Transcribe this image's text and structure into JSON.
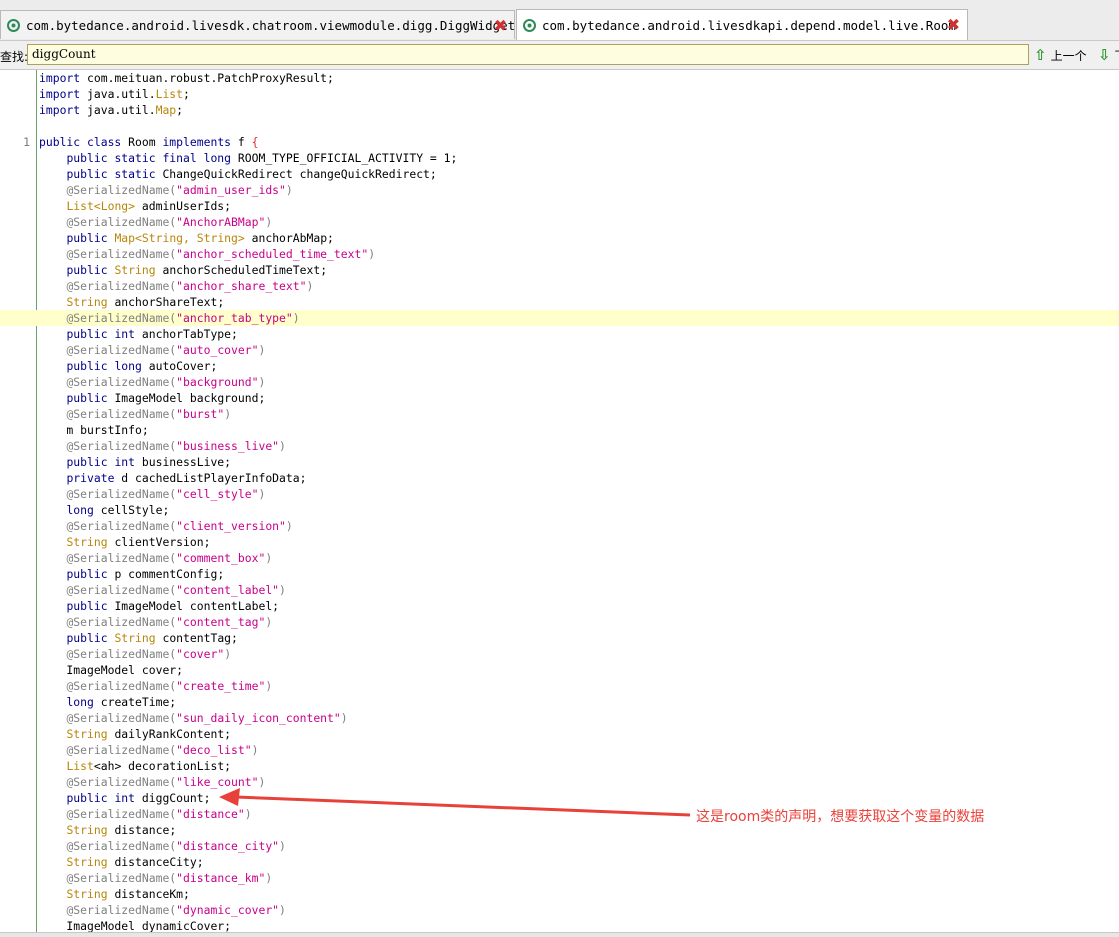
{
  "tabs": [
    {
      "label": "com.bytedance.android.livesdk.chatroom.viewmodule.digg.DiggWidget",
      "close": "✖",
      "active": false
    },
    {
      "label": "com.bytedance.android.livesdkapi.depend.model.live.Room",
      "close": "✖",
      "active": true
    }
  ],
  "find": {
    "label": "查找:",
    "value": "diggCount",
    "prev_label": "上一个",
    "next_label": "下"
  },
  "code_lines": [
    {
      "n": "",
      "hl": false,
      "tokens": [
        {
          "c": "kw",
          "t": "import"
        },
        {
          "c": "",
          "t": " com.meituan.robust.PatchProxyResult;"
        }
      ]
    },
    {
      "n": "",
      "hl": false,
      "tokens": [
        {
          "c": "kw",
          "t": "import"
        },
        {
          "c": "",
          "t": " java.util."
        },
        {
          "c": "ty",
          "t": "List"
        },
        {
          "c": "",
          "t": ";"
        }
      ]
    },
    {
      "n": "",
      "hl": false,
      "tokens": [
        {
          "c": "kw",
          "t": "import"
        },
        {
          "c": "",
          "t": " java.util."
        },
        {
          "c": "ty",
          "t": "Map"
        },
        {
          "c": "",
          "t": ";"
        }
      ]
    },
    {
      "n": "",
      "hl": false,
      "tokens": []
    },
    {
      "n": "1",
      "hl": false,
      "tokens": [
        {
          "c": "kw",
          "t": "public class"
        },
        {
          "c": "",
          "t": " Room "
        },
        {
          "c": "kw",
          "t": "implements"
        },
        {
          "c": "",
          "t": " f "
        },
        {
          "c": "brace",
          "t": "{"
        }
      ]
    },
    {
      "n": "",
      "hl": false,
      "tokens": [
        {
          "c": "",
          "t": "    "
        },
        {
          "c": "kw",
          "t": "public static final long"
        },
        {
          "c": "",
          "t": " ROOM_TYPE_OFFICIAL_ACTIVITY = 1;"
        }
      ]
    },
    {
      "n": "",
      "hl": false,
      "tokens": [
        {
          "c": "",
          "t": "    "
        },
        {
          "c": "kw",
          "t": "public static"
        },
        {
          "c": "",
          "t": " ChangeQuickRedirect changeQuickRedirect;"
        }
      ]
    },
    {
      "n": "",
      "hl": false,
      "tokens": [
        {
          "c": "",
          "t": "    "
        },
        {
          "c": "ann",
          "t": "@SerializedName("
        },
        {
          "c": "str",
          "t": "\"admin_user_ids\""
        },
        {
          "c": "ann",
          "t": ")"
        }
      ]
    },
    {
      "n": "",
      "hl": false,
      "tokens": [
        {
          "c": "",
          "t": "    "
        },
        {
          "c": "ty",
          "t": "List<Long>"
        },
        {
          "c": "",
          "t": " adminUserIds;"
        }
      ]
    },
    {
      "n": "",
      "hl": false,
      "tokens": [
        {
          "c": "",
          "t": "    "
        },
        {
          "c": "ann",
          "t": "@SerializedName("
        },
        {
          "c": "str",
          "t": "\"AnchorABMap\""
        },
        {
          "c": "ann",
          "t": ")"
        }
      ]
    },
    {
      "n": "",
      "hl": false,
      "tokens": [
        {
          "c": "",
          "t": "    "
        },
        {
          "c": "kw",
          "t": "public"
        },
        {
          "c": "",
          "t": " "
        },
        {
          "c": "ty",
          "t": "Map<String, String>"
        },
        {
          "c": "",
          "t": " anchorAbMap;"
        }
      ]
    },
    {
      "n": "",
      "hl": false,
      "tokens": [
        {
          "c": "",
          "t": "    "
        },
        {
          "c": "ann",
          "t": "@SerializedName("
        },
        {
          "c": "str",
          "t": "\"anchor_scheduled_time_text\""
        },
        {
          "c": "ann",
          "t": ")"
        }
      ]
    },
    {
      "n": "",
      "hl": false,
      "tokens": [
        {
          "c": "",
          "t": "    "
        },
        {
          "c": "kw",
          "t": "public"
        },
        {
          "c": "",
          "t": " "
        },
        {
          "c": "ty",
          "t": "String"
        },
        {
          "c": "",
          "t": " anchorScheduledTimeText;"
        }
      ]
    },
    {
      "n": "",
      "hl": false,
      "tokens": [
        {
          "c": "",
          "t": "    "
        },
        {
          "c": "ann",
          "t": "@SerializedName("
        },
        {
          "c": "str",
          "t": "\"anchor_share_text\""
        },
        {
          "c": "ann",
          "t": ")"
        }
      ]
    },
    {
      "n": "",
      "hl": false,
      "tokens": [
        {
          "c": "",
          "t": "    "
        },
        {
          "c": "ty",
          "t": "String"
        },
        {
          "c": "",
          "t": " anchorShareText;"
        }
      ]
    },
    {
      "n": "",
      "hl": true,
      "tokens": [
        {
          "c": "",
          "t": "    "
        },
        {
          "c": "ann",
          "t": "@SerializedName("
        },
        {
          "c": "str",
          "t": "\"anchor_tab_type\""
        },
        {
          "c": "ann",
          "t": ")"
        }
      ]
    },
    {
      "n": "",
      "hl": false,
      "tokens": [
        {
          "c": "",
          "t": "    "
        },
        {
          "c": "kw",
          "t": "public int"
        },
        {
          "c": "",
          "t": " anchorTabType;"
        }
      ]
    },
    {
      "n": "",
      "hl": false,
      "tokens": [
        {
          "c": "",
          "t": "    "
        },
        {
          "c": "ann",
          "t": "@SerializedName("
        },
        {
          "c": "str",
          "t": "\"auto_cover\""
        },
        {
          "c": "ann",
          "t": ")"
        }
      ]
    },
    {
      "n": "",
      "hl": false,
      "tokens": [
        {
          "c": "",
          "t": "    "
        },
        {
          "c": "kw",
          "t": "public long"
        },
        {
          "c": "",
          "t": " autoCover;"
        }
      ]
    },
    {
      "n": "",
      "hl": false,
      "tokens": [
        {
          "c": "",
          "t": "    "
        },
        {
          "c": "ann",
          "t": "@SerializedName("
        },
        {
          "c": "str",
          "t": "\"background\""
        },
        {
          "c": "ann",
          "t": ")"
        }
      ]
    },
    {
      "n": "",
      "hl": false,
      "tokens": [
        {
          "c": "",
          "t": "    "
        },
        {
          "c": "kw",
          "t": "public"
        },
        {
          "c": "",
          "t": " ImageModel background;"
        }
      ]
    },
    {
      "n": "",
      "hl": false,
      "tokens": [
        {
          "c": "",
          "t": "    "
        },
        {
          "c": "ann",
          "t": "@SerializedName("
        },
        {
          "c": "str",
          "t": "\"burst\""
        },
        {
          "c": "ann",
          "t": ")"
        }
      ]
    },
    {
      "n": "",
      "hl": false,
      "tokens": [
        {
          "c": "",
          "t": "    m burstInfo;"
        }
      ]
    },
    {
      "n": "",
      "hl": false,
      "tokens": [
        {
          "c": "",
          "t": "    "
        },
        {
          "c": "ann",
          "t": "@SerializedName("
        },
        {
          "c": "str",
          "t": "\"business_live\""
        },
        {
          "c": "ann",
          "t": ")"
        }
      ]
    },
    {
      "n": "",
      "hl": false,
      "tokens": [
        {
          "c": "",
          "t": "    "
        },
        {
          "c": "kw",
          "t": "public int"
        },
        {
          "c": "",
          "t": " businessLive;"
        }
      ]
    },
    {
      "n": "",
      "hl": false,
      "tokens": [
        {
          "c": "",
          "t": "    "
        },
        {
          "c": "kw",
          "t": "private"
        },
        {
          "c": "",
          "t": " d cachedListPlayerInfoData;"
        }
      ]
    },
    {
      "n": "",
      "hl": false,
      "tokens": [
        {
          "c": "",
          "t": "    "
        },
        {
          "c": "ann",
          "t": "@SerializedName("
        },
        {
          "c": "str",
          "t": "\"cell_style\""
        },
        {
          "c": "ann",
          "t": ")"
        }
      ]
    },
    {
      "n": "",
      "hl": false,
      "tokens": [
        {
          "c": "",
          "t": "    "
        },
        {
          "c": "kw",
          "t": "long"
        },
        {
          "c": "",
          "t": " cellStyle;"
        }
      ]
    },
    {
      "n": "",
      "hl": false,
      "tokens": [
        {
          "c": "",
          "t": "    "
        },
        {
          "c": "ann",
          "t": "@SerializedName("
        },
        {
          "c": "str",
          "t": "\"client_version\""
        },
        {
          "c": "ann",
          "t": ")"
        }
      ]
    },
    {
      "n": "",
      "hl": false,
      "tokens": [
        {
          "c": "",
          "t": "    "
        },
        {
          "c": "ty",
          "t": "String"
        },
        {
          "c": "",
          "t": " clientVersion;"
        }
      ]
    },
    {
      "n": "",
      "hl": false,
      "tokens": [
        {
          "c": "",
          "t": "    "
        },
        {
          "c": "ann",
          "t": "@SerializedName("
        },
        {
          "c": "str",
          "t": "\"comment_box\""
        },
        {
          "c": "ann",
          "t": ")"
        }
      ]
    },
    {
      "n": "",
      "hl": false,
      "tokens": [
        {
          "c": "",
          "t": "    "
        },
        {
          "c": "kw",
          "t": "public"
        },
        {
          "c": "",
          "t": " p commentConfig;"
        }
      ]
    },
    {
      "n": "",
      "hl": false,
      "tokens": [
        {
          "c": "",
          "t": "    "
        },
        {
          "c": "ann",
          "t": "@SerializedName("
        },
        {
          "c": "str",
          "t": "\"content_label\""
        },
        {
          "c": "ann",
          "t": ")"
        }
      ]
    },
    {
      "n": "",
      "hl": false,
      "tokens": [
        {
          "c": "",
          "t": "    "
        },
        {
          "c": "kw",
          "t": "public"
        },
        {
          "c": "",
          "t": " ImageModel contentLabel;"
        }
      ]
    },
    {
      "n": "",
      "hl": false,
      "tokens": [
        {
          "c": "",
          "t": "    "
        },
        {
          "c": "ann",
          "t": "@SerializedName("
        },
        {
          "c": "str",
          "t": "\"content_tag\""
        },
        {
          "c": "ann",
          "t": ")"
        }
      ]
    },
    {
      "n": "",
      "hl": false,
      "tokens": [
        {
          "c": "",
          "t": "    "
        },
        {
          "c": "kw",
          "t": "public"
        },
        {
          "c": "",
          "t": " "
        },
        {
          "c": "ty",
          "t": "String"
        },
        {
          "c": "",
          "t": " contentTag;"
        }
      ]
    },
    {
      "n": "",
      "hl": false,
      "tokens": [
        {
          "c": "",
          "t": "    "
        },
        {
          "c": "ann",
          "t": "@SerializedName("
        },
        {
          "c": "str",
          "t": "\"cover\""
        },
        {
          "c": "ann",
          "t": ")"
        }
      ]
    },
    {
      "n": "",
      "hl": false,
      "tokens": [
        {
          "c": "",
          "t": "    ImageModel cover;"
        }
      ]
    },
    {
      "n": "",
      "hl": false,
      "tokens": [
        {
          "c": "",
          "t": "    "
        },
        {
          "c": "ann",
          "t": "@SerializedName("
        },
        {
          "c": "str",
          "t": "\"create_time\""
        },
        {
          "c": "ann",
          "t": ")"
        }
      ]
    },
    {
      "n": "",
      "hl": false,
      "tokens": [
        {
          "c": "",
          "t": "    "
        },
        {
          "c": "kw",
          "t": "long"
        },
        {
          "c": "",
          "t": " createTime;"
        }
      ]
    },
    {
      "n": "",
      "hl": false,
      "tokens": [
        {
          "c": "",
          "t": "    "
        },
        {
          "c": "ann",
          "t": "@SerializedName("
        },
        {
          "c": "str",
          "t": "\"sun_daily_icon_content\""
        },
        {
          "c": "ann",
          "t": ")"
        }
      ]
    },
    {
      "n": "",
      "hl": false,
      "tokens": [
        {
          "c": "",
          "t": "    "
        },
        {
          "c": "ty",
          "t": "String"
        },
        {
          "c": "",
          "t": " dailyRankContent;"
        }
      ]
    },
    {
      "n": "",
      "hl": false,
      "tokens": [
        {
          "c": "",
          "t": "    "
        },
        {
          "c": "ann",
          "t": "@SerializedName("
        },
        {
          "c": "str",
          "t": "\"deco_list\""
        },
        {
          "c": "ann",
          "t": ")"
        }
      ]
    },
    {
      "n": "",
      "hl": false,
      "tokens": [
        {
          "c": "",
          "t": "    "
        },
        {
          "c": "ty",
          "t": "List"
        },
        {
          "c": "",
          "t": "<ah> decorationList;"
        }
      ]
    },
    {
      "n": "",
      "hl": false,
      "tokens": [
        {
          "c": "",
          "t": "    "
        },
        {
          "c": "ann",
          "t": "@SerializedName("
        },
        {
          "c": "str",
          "t": "\"like_count\""
        },
        {
          "c": "ann",
          "t": ")"
        }
      ]
    },
    {
      "n": "",
      "hl": false,
      "tokens": [
        {
          "c": "",
          "t": "    "
        },
        {
          "c": "kw",
          "t": "public int"
        },
        {
          "c": "",
          "t": " diggCount;"
        }
      ]
    },
    {
      "n": "",
      "hl": false,
      "tokens": [
        {
          "c": "",
          "t": "    "
        },
        {
          "c": "ann",
          "t": "@SerializedName("
        },
        {
          "c": "str",
          "t": "\"distance\""
        },
        {
          "c": "ann",
          "t": ")"
        }
      ]
    },
    {
      "n": "",
      "hl": false,
      "tokens": [
        {
          "c": "",
          "t": "    "
        },
        {
          "c": "ty",
          "t": "String"
        },
        {
          "c": "",
          "t": " distance;"
        }
      ]
    },
    {
      "n": "",
      "hl": false,
      "tokens": [
        {
          "c": "",
          "t": "    "
        },
        {
          "c": "ann",
          "t": "@SerializedName("
        },
        {
          "c": "str",
          "t": "\"distance_city\""
        },
        {
          "c": "ann",
          "t": ")"
        }
      ]
    },
    {
      "n": "",
      "hl": false,
      "tokens": [
        {
          "c": "",
          "t": "    "
        },
        {
          "c": "ty",
          "t": "String"
        },
        {
          "c": "",
          "t": " distanceCity;"
        }
      ]
    },
    {
      "n": "",
      "hl": false,
      "tokens": [
        {
          "c": "",
          "t": "    "
        },
        {
          "c": "ann",
          "t": "@SerializedName("
        },
        {
          "c": "str",
          "t": "\"distance_km\""
        },
        {
          "c": "ann",
          "t": ")"
        }
      ]
    },
    {
      "n": "",
      "hl": false,
      "tokens": [
        {
          "c": "",
          "t": "    "
        },
        {
          "c": "ty",
          "t": "String"
        },
        {
          "c": "",
          "t": " distanceKm;"
        }
      ]
    },
    {
      "n": "",
      "hl": false,
      "tokens": [
        {
          "c": "",
          "t": "    "
        },
        {
          "c": "ann",
          "t": "@SerializedName("
        },
        {
          "c": "str",
          "t": "\"dynamic_cover\""
        },
        {
          "c": "ann",
          "t": ")"
        }
      ]
    },
    {
      "n": "",
      "hl": false,
      "tokens": [
        {
          "c": "",
          "t": "    ImageModel dynamicCover;"
        }
      ]
    }
  ],
  "annotation": {
    "text": "这是room类的声明，想要获取这个变量的数据",
    "color": "#e8413a"
  },
  "icons": {
    "tab_icon": "class-file-icon",
    "close_icon": "close-icon",
    "prev_icon": "arrow-up-icon",
    "next_icon": "arrow-down-icon"
  }
}
